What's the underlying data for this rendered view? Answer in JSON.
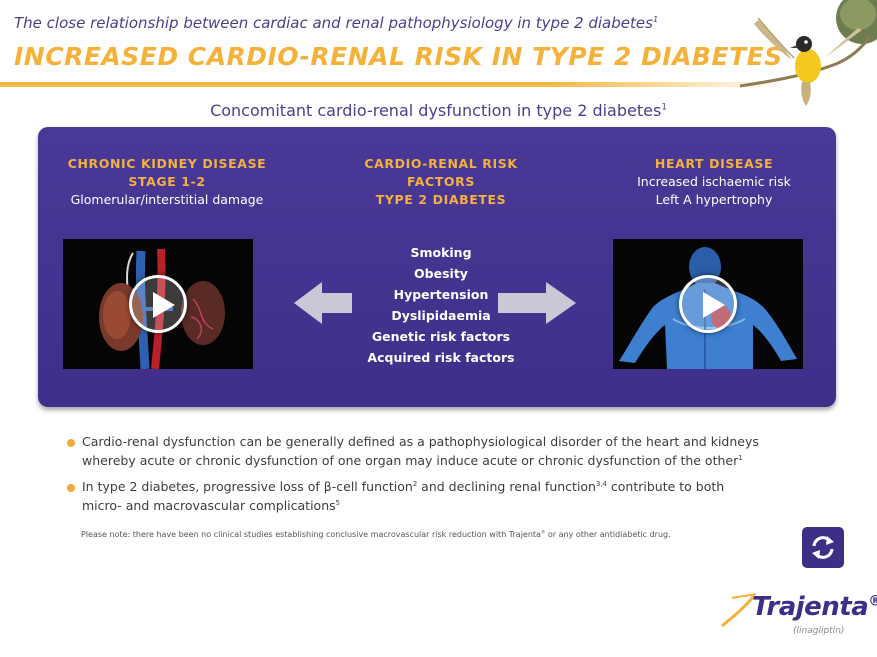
{
  "header": {
    "subtitle": "The close relationship between cardiac and renal pathophysiology in type 2 diabetes",
    "subtitle_ref": "1",
    "title": "INCREASED CARDIO-RENAL RISK IN TYPE 2 DIABETES"
  },
  "section": {
    "heading": "Concomitant cardio-renal dysfunction in type 2 diabetes",
    "heading_ref": "1"
  },
  "panel": {
    "left": {
      "title_line1": "CHRONIC KIDNEY DISEASE",
      "title_line2": "STAGE 1-2",
      "detail": "Glomerular/interstitial damage",
      "video_icon": "play-icon"
    },
    "middle": {
      "title_line1": "CARDIO-RENAL RISK FACTORS",
      "title_line2": "TYPE 2 DIABETES",
      "factors": [
        "Smoking",
        "Obesity",
        "Hypertension",
        "Dyslipidaemia",
        "Genetic risk factors",
        "Acquired risk factors"
      ]
    },
    "right": {
      "title_line1": "HEART DISEASE",
      "detail_line1": "Increased ischaemic risk",
      "detail_line2": "Left A hypertrophy",
      "video_icon": "play-icon"
    }
  },
  "bullets": [
    {
      "part1": "Cardio-renal dysfunction can be generally defined as a pathophysiological disorder of the heart and kidneys whereby acute or chronic dysfunction of one organ may induce acute or chronic dysfunction of the other",
      "ref1": "1"
    },
    {
      "part1": "In type 2 diabetes, progressive loss of β-cell function",
      "ref1": "2",
      "part2": " and declining renal function",
      "ref2": "3,4",
      "part3": " contribute to both micro- and macrovascular complications",
      "ref3": "5"
    }
  ],
  "note": {
    "part1": "Please note: there have been no clinical studies establishing conclusive macrovascular risk reduction with Trajenta",
    "mark": "®",
    "part2": " or any other antidiabetic drug."
  },
  "nav": {
    "icon": "refresh-icon"
  },
  "logo": {
    "word": "Trajenta",
    "mark": "®",
    "sub": "(linagliptin)"
  },
  "colors": {
    "accent": "#f4b23a",
    "panel": "#4a3896",
    "brand": "#3e2e86"
  }
}
